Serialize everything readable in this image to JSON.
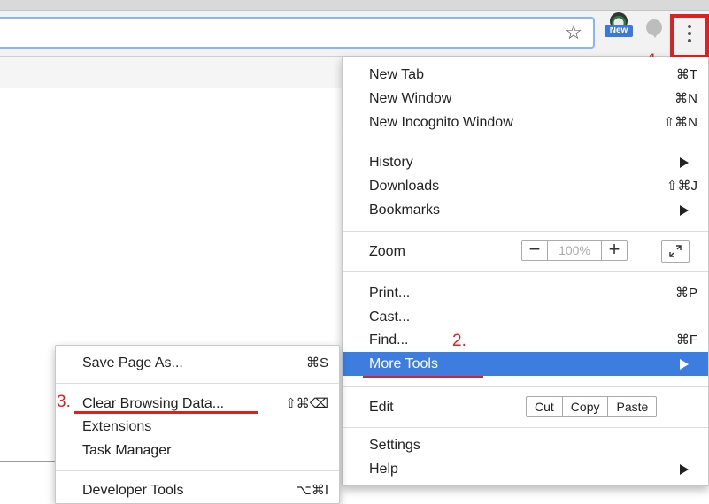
{
  "toolbar": {
    "star_icon": "star-icon",
    "extension_badge": "New",
    "menu_icon": "kebab-icon"
  },
  "annotations": {
    "step1": "1.",
    "step2": "2.",
    "step3": "3.",
    "highlight_color": "#e02020"
  },
  "main_menu": {
    "new_tab": {
      "label": "New Tab",
      "shortcut": "⌘T"
    },
    "new_window": {
      "label": "New Window",
      "shortcut": "⌘N"
    },
    "new_incognito": {
      "label": "New Incognito Window",
      "shortcut": "⇧⌘N"
    },
    "history": {
      "label": "History"
    },
    "downloads": {
      "label": "Downloads",
      "shortcut": "⇧⌘J"
    },
    "bookmarks": {
      "label": "Bookmarks"
    },
    "zoom": {
      "label": "Zoom",
      "minus": "−",
      "value": "100%",
      "plus": "+"
    },
    "print": {
      "label": "Print...",
      "shortcut": "⌘P"
    },
    "cast": {
      "label": "Cast..."
    },
    "find": {
      "label": "Find...",
      "shortcut": "⌘F"
    },
    "more_tools": {
      "label": "More Tools"
    },
    "edit": {
      "label": "Edit",
      "cut": "Cut",
      "copy": "Copy",
      "paste": "Paste"
    },
    "settings": {
      "label": "Settings"
    },
    "help": {
      "label": "Help"
    },
    "highlight_color": "#3d7de0"
  },
  "sub_menu": {
    "save_page": {
      "label": "Save Page As...",
      "shortcut": "⌘S"
    },
    "clear_browsing": {
      "label": "Clear Browsing Data...",
      "shortcut": "⇧⌘⌫"
    },
    "extensions": {
      "label": "Extensions"
    },
    "task_manager": {
      "label": "Task Manager"
    },
    "developer_tools": {
      "label": "Developer Tools",
      "shortcut": "⌥⌘I"
    }
  }
}
